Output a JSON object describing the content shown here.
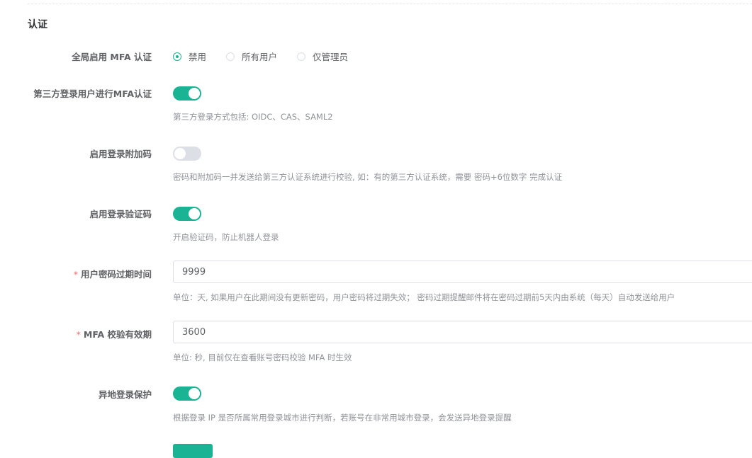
{
  "section": {
    "title": "认证"
  },
  "mfa_global": {
    "label": "全局启用 MFA 认证",
    "options": [
      "禁用",
      "所有用户",
      "仅管理员"
    ],
    "selected_index": 0
  },
  "third_party_mfa": {
    "label": "第三方登录用户进行MFA认证",
    "enabled": true,
    "help": "第三方登录方式包括: OIDC、CAS、SAML2"
  },
  "login_suffix": {
    "label": "启用登录附加码",
    "enabled": false,
    "help": "密码和附加码一并发送给第三方认证系统进行校验, 如：有的第三方认证系统，需要 密码+6位数字 完成认证"
  },
  "login_captcha": {
    "label": "启用登录验证码",
    "enabled": true,
    "help": "开启验证码，防止机器人登录"
  },
  "password_expire": {
    "required_mark": "*",
    "label": "用户密码过期时间",
    "value": "9999",
    "help": "单位：天, 如果用户在此期间没有更新密码，用户密码将过期失效； 密码过期提醒邮件将在密码过期前5天内由系统（每天）自动发送给用户"
  },
  "mfa_ttl": {
    "required_mark": "*",
    "label": "MFA 校验有效期",
    "value": "3600",
    "help": "单位: 秒, 目前仅在查看账号密码校验 MFA 时生效"
  },
  "remote_login_protection": {
    "label": "异地登录保护",
    "enabled": true,
    "help": "根据登录 IP 是否所属常用登录城市进行判断，若账号在非常用城市登录，会发送异地登录提醒"
  },
  "colors": {
    "accent": "#1ab394",
    "required": "#f56c6c"
  }
}
